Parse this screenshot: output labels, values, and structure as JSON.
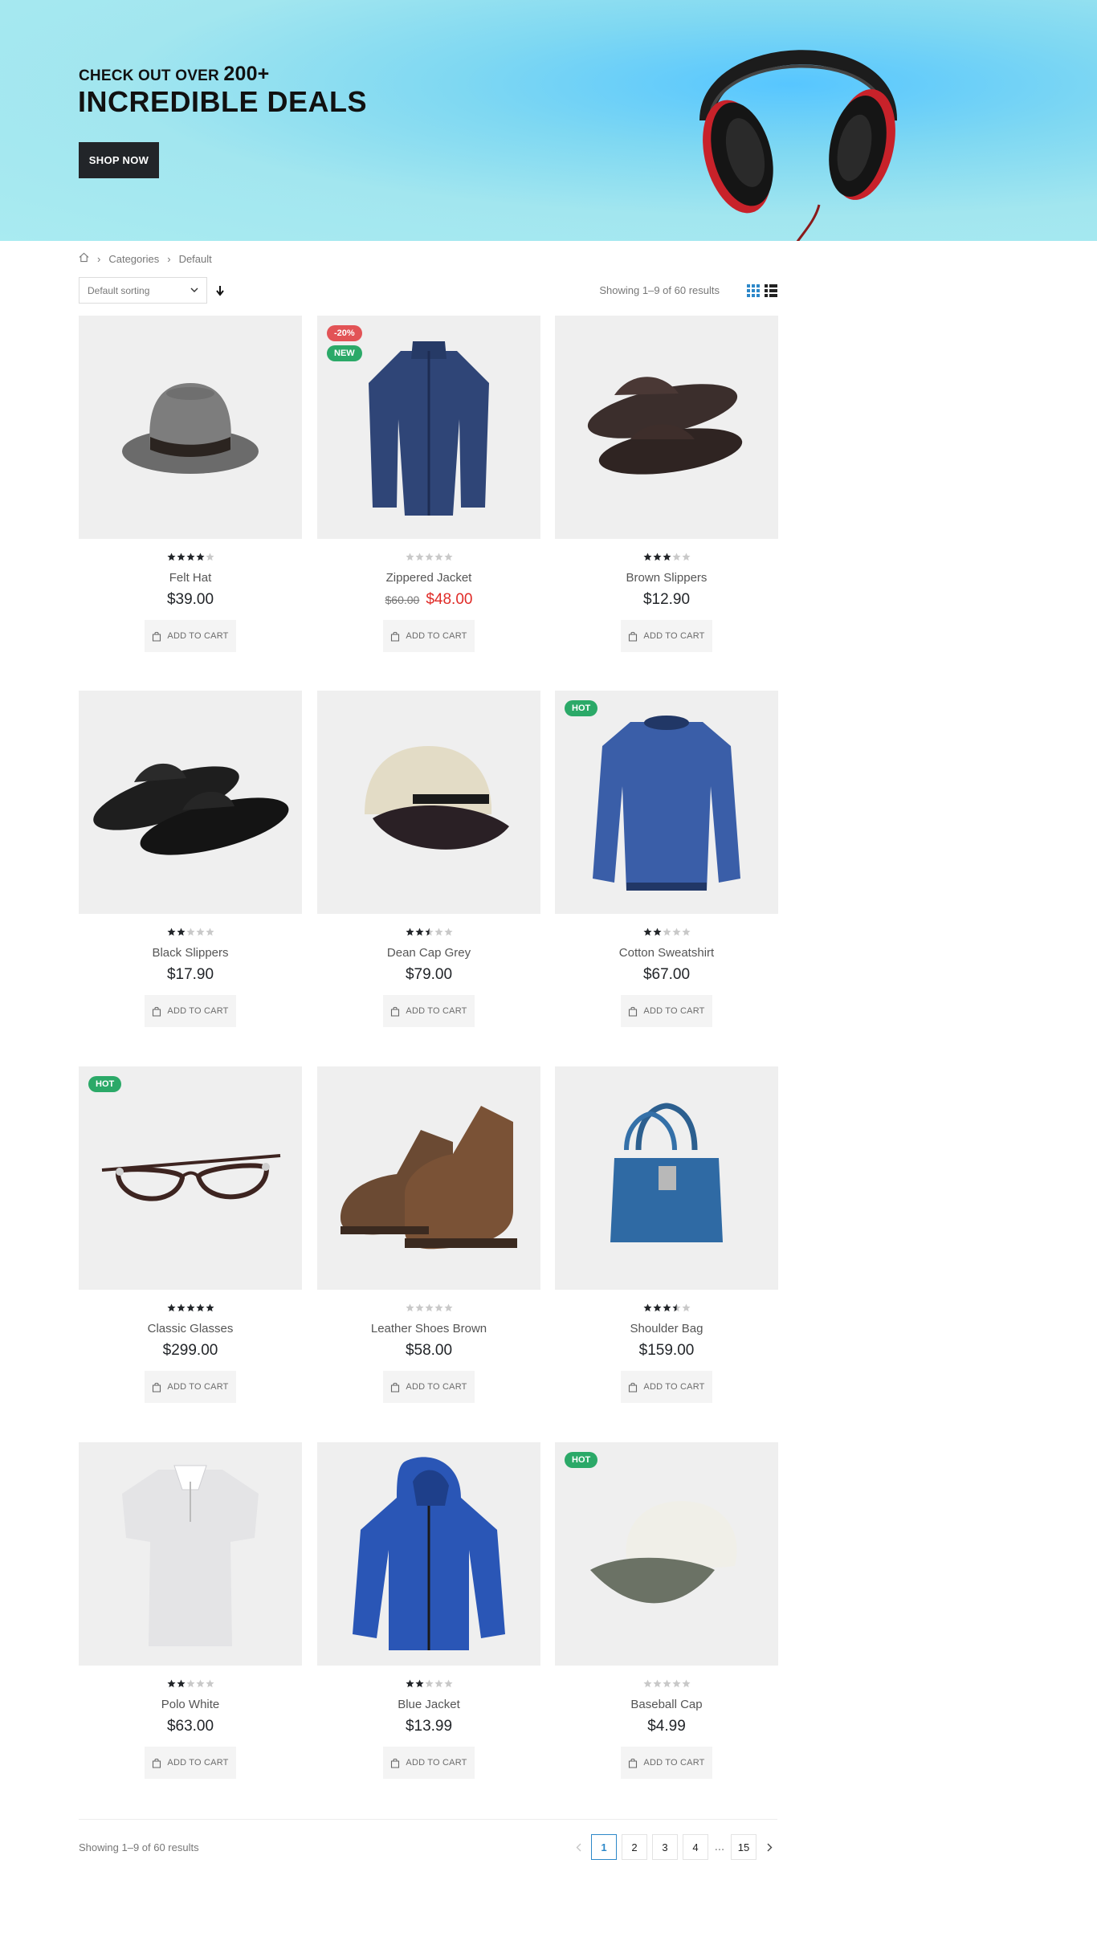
{
  "banner": {
    "pre_text": "CHECK OUT OVER ",
    "pre_number": "200+",
    "headline": "INCREDIBLE DEALS",
    "button_label": "SHOP NOW"
  },
  "breadcrumb": {
    "items": [
      "Categories",
      "Default"
    ]
  },
  "toolbar": {
    "sort_value": "Default sorting",
    "showing_text": "Showing 1–9 of 60 results"
  },
  "products": [
    {
      "name": "Felt Hat",
      "price": "$39.00",
      "old_price": "",
      "rating": 4,
      "badges": [],
      "cart_label": "ADD TO CART"
    },
    {
      "name": "Zippered Jacket",
      "price": "$48.00",
      "old_price": "$60.00",
      "rating": 0,
      "badges": [
        "-20%",
        "NEW"
      ],
      "cart_label": "ADD TO CART"
    },
    {
      "name": "Brown Slippers",
      "price": "$12.90",
      "old_price": "",
      "rating": 3,
      "badges": [],
      "cart_label": "ADD TO CART"
    },
    {
      "name": "Black Slippers",
      "price": "$17.90",
      "old_price": "",
      "rating": 2,
      "badges": [],
      "cart_label": "ADD TO CART"
    },
    {
      "name": "Dean Cap Grey",
      "price": "$79.00",
      "old_price": "",
      "rating": 2.5,
      "badges": [],
      "cart_label": "ADD TO CART"
    },
    {
      "name": "Cotton Sweatshirt",
      "price": "$67.00",
      "old_price": "",
      "rating": 2,
      "badges": [
        "HOT"
      ],
      "cart_label": "ADD TO CART"
    },
    {
      "name": "Classic Glasses",
      "price": "$299.00",
      "old_price": "",
      "rating": 5,
      "badges": [
        "HOT"
      ],
      "cart_label": "ADD TO CART"
    },
    {
      "name": "Leather Shoes Brown",
      "price": "$58.00",
      "old_price": "",
      "rating": 0,
      "badges": [],
      "cart_label": "ADD TO CART"
    },
    {
      "name": "Shoulder Bag",
      "price": "$159.00",
      "old_price": "",
      "rating": 3.5,
      "badges": [],
      "cart_label": "ADD TO CART"
    },
    {
      "name": "Polo White",
      "price": "$63.00",
      "old_price": "",
      "rating": 2,
      "badges": [],
      "cart_label": "ADD TO CART"
    },
    {
      "name": "Blue Jacket",
      "price": "$13.99",
      "old_price": "",
      "rating": 2,
      "badges": [],
      "cart_label": "ADD TO CART"
    },
    {
      "name": "Baseball Cap",
      "price": "$4.99",
      "old_price": "",
      "rating": 0,
      "badges": [
        "HOT"
      ],
      "cart_label": "ADD TO CART"
    }
  ],
  "pagination": {
    "showing_text": "Showing 1–9 of 60 results",
    "pages": [
      "1",
      "2",
      "3",
      "4"
    ],
    "dots": "...",
    "last_page": "15",
    "current": "1"
  },
  "colors": {
    "accent": "#2d88c9",
    "badge_sale": "#e25356",
    "badge_new": "#2ba968",
    "price_sale": "#e02b27",
    "dark": "#222529"
  }
}
